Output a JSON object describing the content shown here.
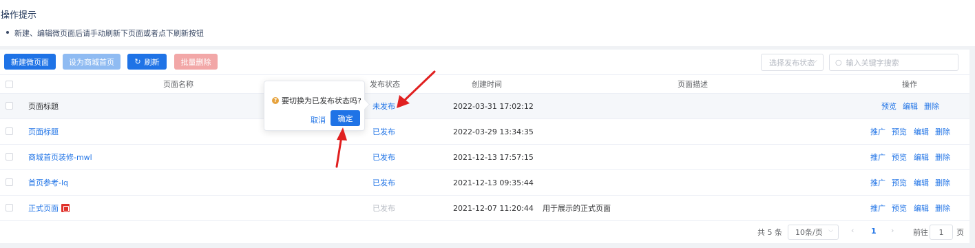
{
  "tips": {
    "title": "操作提示",
    "item": "新建、编辑微页面后请手动刷新下页面或者点下刷新按钮"
  },
  "toolbar": {
    "new_label": "新建微页面",
    "set_home_label": "设为商城首页",
    "refresh_label": "刷新",
    "batch_delete_label": "批量删除",
    "status_select_placeholder": "选择发布状态",
    "search_placeholder": "输入关键字搜索"
  },
  "table": {
    "headers": {
      "name": "页面名称",
      "status": "发布状态",
      "created": "创建时间",
      "desc": "页面描述",
      "ops": "操作"
    },
    "rows": [
      {
        "name": "页面标题",
        "status": "未发布",
        "created": "2022-03-31 17:02:12",
        "desc": "",
        "ops": [
          "预览",
          "编辑",
          "删除"
        ]
      },
      {
        "name": "页面标题",
        "status": "已发布",
        "created": "2022-03-29 13:34:35",
        "desc": "",
        "ops": [
          "推广",
          "预览",
          "编辑",
          "删除"
        ]
      },
      {
        "name": "商城首页装修-mwl",
        "status": "已发布",
        "created": "2021-12-13 17:57:15",
        "desc": "",
        "ops": [
          "推广",
          "预览",
          "编辑",
          "删除"
        ]
      },
      {
        "name": "首页参考-lq",
        "status": "已发布",
        "created": "2021-12-13 09:35:44",
        "desc": "",
        "ops": [
          "推广",
          "预览",
          "编辑",
          "删除"
        ]
      },
      {
        "name": "正式页面",
        "status": "已发布",
        "created": "2021-12-07 11:20:44",
        "desc": "用于展示的正式页面",
        "ops": [
          "推广",
          "预览",
          "编辑",
          "删除"
        ]
      }
    ]
  },
  "pagination": {
    "total": "共 5 条",
    "page_size": "10条/页",
    "current_page": "1",
    "goto_label": "前往",
    "goto_value": "1",
    "page_unit": "页"
  },
  "popconfirm": {
    "message": "要切换为已发布状态吗?",
    "cancel": "取消",
    "confirm": "确定"
  },
  "colors": {
    "primary": "#1f73e6",
    "danger_light": "#f2a7a7",
    "warning": "#e6a23c",
    "annotation": "#e02020"
  }
}
